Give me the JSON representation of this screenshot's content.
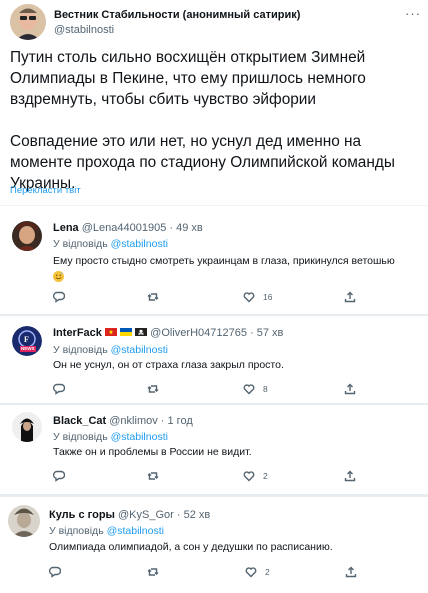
{
  "main_tweet": {
    "author_name": "Вестник Стабильности (анонимный сатирик)",
    "author_handle": "@stabilnosti",
    "paragraph1": "Путин столь сильно восхищён открытием Зимней Олимпиады в Пекине, что ему пришлось немного вздремнуть, чтобы сбить чувство эйфории",
    "paragraph2": "Совпадение это или нет, но уснул дед именно на моменте прохода по стадиону Олимпийской команды Украины.",
    "translate_label": "Перекласти твіт"
  },
  "replies": [
    {
      "author_name": "Lena",
      "author_handle": "@Lena44001905",
      "time": "· 49 хв",
      "reply_prefix": "У відповідь",
      "reply_to": "@stabilnosti",
      "text": "Ему просто стыдно смотреть украинцам в глаза, прикинулся ветошью",
      "emoji": "sweat-smile-emoji",
      "likes": "16"
    },
    {
      "author_name": "InterFack",
      "author_handle": "@OliverH04712765",
      "time": "· 57 хв",
      "reply_prefix": "У відповідь",
      "reply_to": "@stabilnosti",
      "text": "Он не уснул, он от страха глаза закрыл просто.",
      "likes": "8",
      "avatar_text": "NEWS"
    },
    {
      "author_name": "Black_Cat",
      "author_handle": "@nklimov",
      "time": "· 1 год",
      "reply_prefix": "У відповідь",
      "reply_to": "@stabilnosti",
      "text": "Также он и проблемы в России не видит.",
      "likes": "2"
    },
    {
      "author_name": "Куль с горы",
      "author_handle": "@KyS_Gor",
      "time": "· 52 хв",
      "reply_prefix": "У відповідь",
      "reply_to": "@stabilnosti",
      "text": "Олимпиада олимпиадой, а сон у дедушки по расписанию.",
      "likes": "2"
    }
  ],
  "colors": {
    "link": "#1d9bf0",
    "secondary": "#536471",
    "text": "#0f1419"
  },
  "icons": [
    "more-icon",
    "reply-icon",
    "retweet-icon",
    "like-icon",
    "share-icon",
    "flag-vietnam-icon",
    "flag-ukraine-icon",
    "pirate-flag-icon"
  ]
}
